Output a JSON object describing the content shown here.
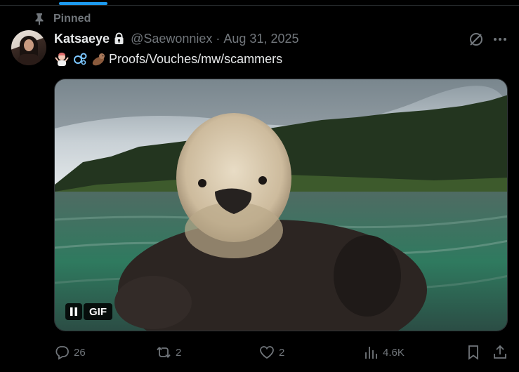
{
  "pinned_label": "Pinned",
  "tweet": {
    "display_name": "Katsaeye",
    "handle": "@Saewonniex",
    "separator": "·",
    "date": "Aug 31, 2025",
    "text": "Proofs/Vouches/mw/scammers",
    "emojis": [
      "person-shrugging-emoji",
      "bubbles-emoji",
      "otter-emoji"
    ]
  },
  "media": {
    "badge": "GIF",
    "subject": "sea otter in water"
  },
  "actions": {
    "replies": "26",
    "reposts": "2",
    "likes": "2",
    "views": "4.6K"
  },
  "colors": {
    "background": "#000000",
    "text_primary": "#e7e9ea",
    "text_secondary": "#71767b",
    "accent": "#1d9bf0",
    "border": "#2f3336"
  }
}
